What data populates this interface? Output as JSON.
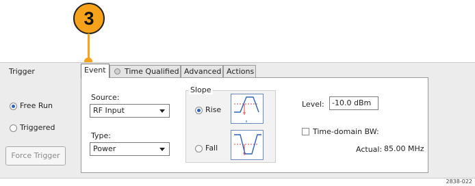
{
  "callout": {
    "number": "3"
  },
  "section": {
    "title": "Trigger"
  },
  "mode": {
    "free_run_label": "Free Run",
    "triggered_label": "Triggered",
    "selected": "Free Run",
    "force_trigger_label": "Force Trigger"
  },
  "tabs": [
    {
      "label": "Event",
      "active": true
    },
    {
      "label": "Time Qualified",
      "icon": "clock-icon"
    },
    {
      "label": "Advanced"
    },
    {
      "label": "Actions"
    }
  ],
  "event": {
    "source_label": "Source:",
    "source_value": "RF Input",
    "type_label": "Type:",
    "type_value": "Power",
    "slope_label": "Slope",
    "rise_label": "Rise",
    "fall_label": "Fall",
    "slope_selected": "Rise",
    "level_label": "Level:",
    "level_value": "-10.0 dBm",
    "tdbw_label": "Time-domain BW:",
    "actual_label": "Actual:",
    "actual_value": "85.00 MHz"
  },
  "figure_id": "2838-022",
  "colors": {
    "callout": "#f7a21b",
    "radio_dot": "#2b62b8",
    "panel": "#ececec"
  }
}
